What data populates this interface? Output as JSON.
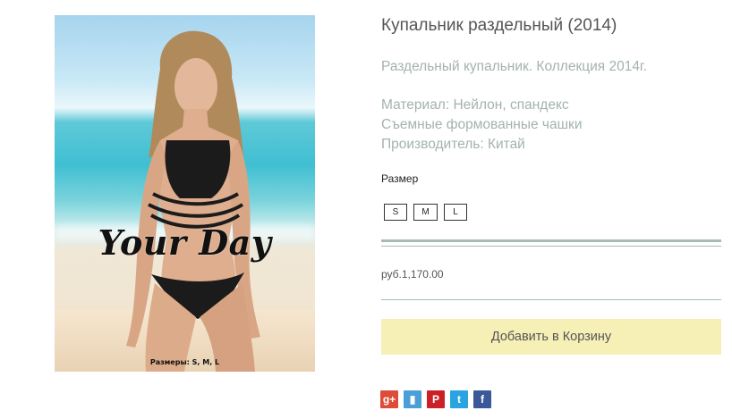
{
  "product": {
    "image": {
      "brand": "Your Day",
      "sizes_caption": "Размеры: S, M, L"
    },
    "title": "Купальник раздельный (2014)",
    "description": [
      "Раздельный купальник. Коллекция 2014г.",
      "Материал: Нейлон, спандекс",
      "Съемные формованные чашки",
      "Производитель: Китай"
    ],
    "size_label": "Размер",
    "sizes": [
      "S",
      "M",
      "L"
    ],
    "price": "руб.1,170.00",
    "add_to_cart": "Добавить в Корзину"
  },
  "share": {
    "icons": [
      {
        "name": "google-plus-icon",
        "glyph": "g+",
        "color": "#dd4b39"
      },
      {
        "name": "blogger-icon",
        "glyph": "▮",
        "color": "#4a9fd8"
      },
      {
        "name": "pinterest-icon",
        "glyph": "P",
        "color": "#cb2027"
      },
      {
        "name": "twitter-icon",
        "glyph": "t",
        "color": "#2aa3e0"
      },
      {
        "name": "facebook-icon",
        "glyph": "f",
        "color": "#3b5998"
      }
    ]
  }
}
